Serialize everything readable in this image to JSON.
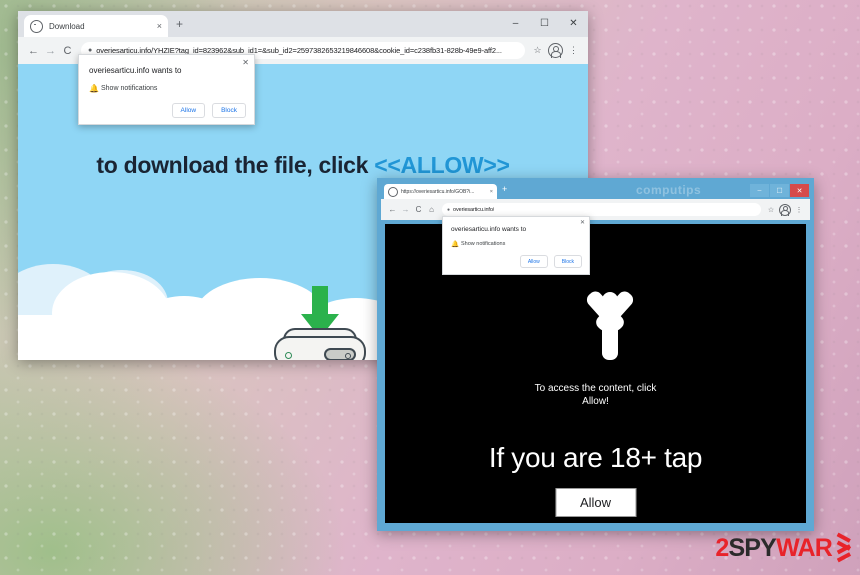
{
  "background": {
    "gradient_from": "#b9c8a6",
    "gradient_to": "#cfa1bb"
  },
  "window1": {
    "tab": {
      "title": "Download",
      "close_label": "×",
      "favicon_name": "globe-icon"
    },
    "new_tab_label": "+",
    "window_controls": {
      "minimize": "–",
      "maximize": "☐",
      "close": "✕"
    },
    "toolbar": {
      "back": "←",
      "forward": "→",
      "reload": "C",
      "lock": "●",
      "url": "overiesarticu.info/YHZIE?tag_id=823962&sub_id1=&sub_id2=2597382653219846608&cookie_id=c238fb31-828b-49e9-aff2...",
      "bookmark_star": "☆",
      "menu": "⋮"
    },
    "page": {
      "headline_part1": "to download the file, click",
      "headline_allow": "<<ALLOW>>",
      "headline_color": "#1a2433",
      "allow_color": "#2196d6",
      "page_background": "#8fd6f5",
      "arrow_color": "#2bb24c"
    },
    "notification": {
      "title": "overiesarticu.info wants to",
      "permission": "Show notifications",
      "allow_label": "Allow",
      "block_label": "Block",
      "close_label": "✕",
      "bell_icon": "🔔",
      "link_color": "#1a73e8"
    }
  },
  "window2": {
    "watermark": "computips",
    "tab": {
      "title": "https://overiesarticu.info/GOB?i...",
      "close_label": "×",
      "favicon_name": "globe-icon"
    },
    "new_tab_label": "+",
    "window_controls": {
      "minimize": "–",
      "maximize": "☐",
      "close": "✕"
    },
    "toolbar": {
      "back": "←",
      "forward": "→",
      "reload": "C",
      "home": "⌂",
      "lock": "●",
      "url": "overiesarticu.info/",
      "bookmark_star": "☆",
      "menu": "⋮"
    },
    "page": {
      "subtext_line1": "To access the content, click",
      "subtext_line2": "Allow!",
      "big_text": "If you are 18+ tap",
      "allow_button": "Allow",
      "page_background": "#000000"
    },
    "notification": {
      "title": "overiesarticu.info wants to",
      "permission": "Show notifications",
      "allow_label": "Allow",
      "block_label": "Block",
      "close_label": "✕",
      "bell_icon": "🔔"
    }
  },
  "logo": {
    "digit": "2",
    "spy": "SPY",
    "war": "WAR",
    "red": "#e8232a",
    "dark": "#2b2b2b"
  }
}
